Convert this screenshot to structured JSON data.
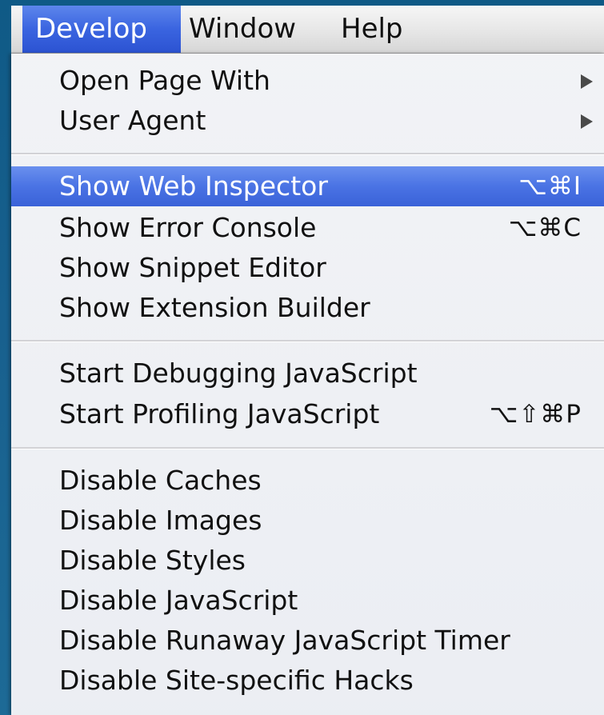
{
  "menubar": {
    "items": [
      {
        "label": "Develop",
        "active": true
      },
      {
        "label": "Window",
        "active": false
      },
      {
        "label": "Help",
        "active": false
      }
    ]
  },
  "menu": {
    "groups": [
      [
        {
          "label": "Open Page With",
          "submenu": true
        },
        {
          "label": "User Agent",
          "submenu": true
        }
      ],
      [
        {
          "label": "Show Web Inspector",
          "shortcut": "⌥⌘I",
          "highlighted": true
        },
        {
          "label": "Show Error Console",
          "shortcut": "⌥⌘C"
        },
        {
          "label": "Show Snippet Editor"
        },
        {
          "label": "Show Extension Builder"
        }
      ],
      [
        {
          "label": "Start Debugging JavaScript"
        },
        {
          "label": "Start Profiling JavaScript",
          "shortcut": "⌥⇧⌘P"
        }
      ],
      [
        {
          "label": "Disable Caches"
        },
        {
          "label": "Disable Images"
        },
        {
          "label": "Disable Styles"
        },
        {
          "label": "Disable JavaScript"
        },
        {
          "label": "Disable Runaway JavaScript Timer"
        },
        {
          "label": "Disable Site-specific Hacks"
        }
      ]
    ]
  },
  "colors": {
    "highlight": "#4a73e4",
    "desktop": "#1a5d84",
    "menu_bg": "#f4f4f6"
  }
}
